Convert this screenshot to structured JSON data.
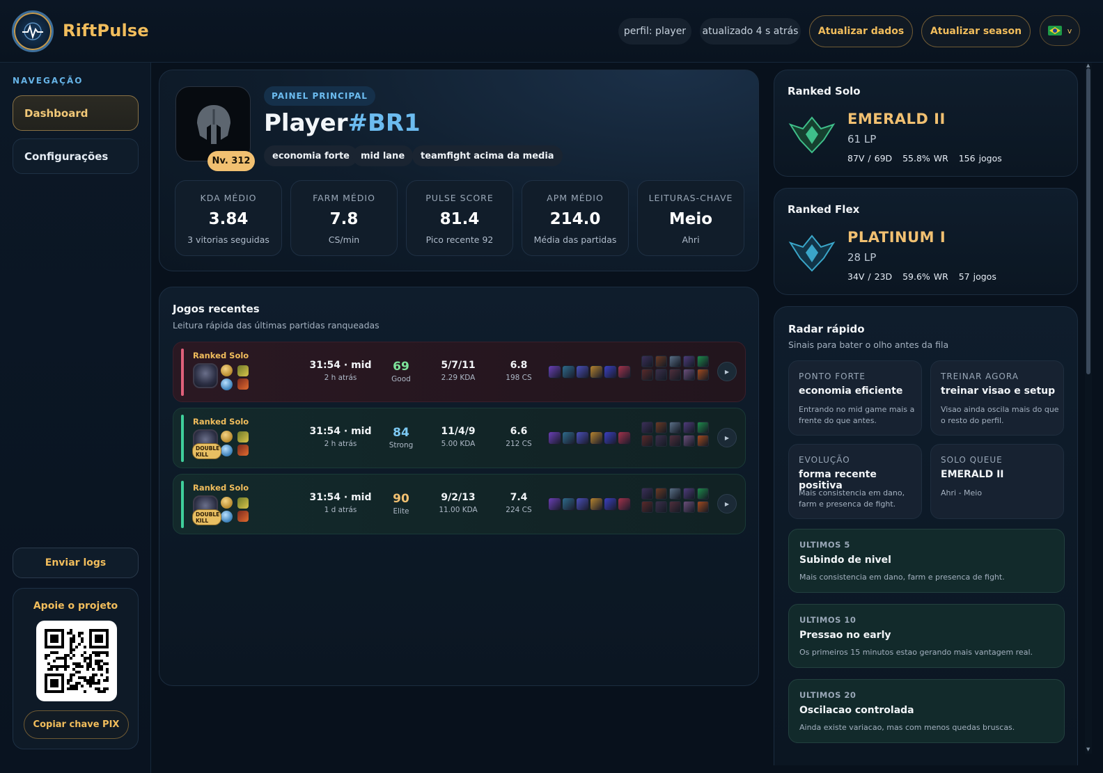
{
  "app": {
    "brand": "RiftPulse",
    "profile_chip": "perfil: player",
    "updated_chip": "atualizado 4 s atrás",
    "refresh_data_label": "Atualizar dados",
    "refresh_season_label": "Atualizar season",
    "language_caret": "v",
    "language_icon": "brazil-flag-icon"
  },
  "sidebar": {
    "title": "NAVEGAÇÃO",
    "items": [
      {
        "label": "Dashboard",
        "active": true
      },
      {
        "label": "Configurações",
        "active": false
      }
    ],
    "send_logs": "Enviar logs",
    "support_title": "Apoie o projeto",
    "copy_pix": "Copiar chave PIX"
  },
  "profile": {
    "pill": "PAINEL PRINCIPAL",
    "name": "Player",
    "tag": "#BR1",
    "level": "Nv. 312",
    "tags": [
      "economia forte",
      "mid lane",
      "teamfight acima da media"
    ],
    "stats": [
      {
        "label": "KDA MÉDIO",
        "value": "3.84",
        "sub": "3 vitorias seguidas"
      },
      {
        "label": "FARM MÉDIO",
        "value": "7.8",
        "sub": "CS/min"
      },
      {
        "label": "PULSE SCORE",
        "value": "81.4",
        "sub": "Pico recente 92"
      },
      {
        "label": "APM MÉDIO",
        "value": "214.0",
        "sub": "Média das partidas"
      },
      {
        "label": "LEITURAS-CHAVE",
        "value": "Meio",
        "sub": "Ahri"
      }
    ]
  },
  "recent": {
    "title": "Jogos recentes",
    "subtitle": "Leitura rápida das últimas partidas ranqueadas",
    "games": [
      {
        "queue": "Ranked Solo",
        "result": "loss",
        "badge": "",
        "time": "31:54 · mid",
        "ago": "2 h atrás",
        "score": "69",
        "score_label": "Good",
        "score_color": "#7de39a",
        "kda": "5/7/11",
        "kda_ratio": "2.29 KDA",
        "cs_per_min": "6.8",
        "cs": "198 CS"
      },
      {
        "queue": "Ranked Solo",
        "result": "win",
        "badge": "DOUBLE KILL",
        "time": "31:54 · mid",
        "ago": "2 h atrás",
        "score": "84",
        "score_label": "Strong",
        "score_color": "#7cc8f2",
        "kda": "11/4/9",
        "kda_ratio": "5.00 KDA",
        "cs_per_min": "6.6",
        "cs": "212 CS"
      },
      {
        "queue": "Ranked Solo",
        "result": "win",
        "badge": "DOUBLE KILL",
        "time": "31:54 · mid",
        "ago": "1 d atrás",
        "score": "90",
        "score_label": "Elite",
        "score_color": "#f1c071",
        "kda": "9/2/13",
        "kda_ratio": "11.00 KDA",
        "cs_per_min": "7.4",
        "cs": "224 CS"
      }
    ]
  },
  "ranks": [
    {
      "queue": "Ranked Solo",
      "tier": "EMERALD II",
      "lp": "61 LP",
      "record": "87V / 69D",
      "wr": "55.8% WR",
      "games": "156 jogos",
      "emblem": "emerald-emblem-icon",
      "color": "#3fbf8a"
    },
    {
      "queue": "Ranked Flex",
      "tier": "PLATINUM I",
      "lp": "28 LP",
      "record": "34V / 23D",
      "wr": "59.6% WR",
      "games": "57 jogos",
      "emblem": "platinum-emblem-icon",
      "color": "#3aa6c9"
    }
  ],
  "radar": {
    "title": "Radar rápido",
    "subtitle": "Sinais para bater o olho antes da fila",
    "boxes": [
      {
        "kicker": "PONTO FORTE",
        "head": "economia eficiente",
        "text": "Entrando no mid game mais a frente do que antes."
      },
      {
        "kicker": "TREINAR AGORA",
        "head": "treinar visao e setup",
        "text": "Visao ainda oscila mais do que o resto do perfil."
      },
      {
        "kicker": "EVOLUÇÃO",
        "head": "forma recente positiva",
        "text": "Mais consistencia em dano, farm e presenca de fight."
      },
      {
        "kicker": "SOLO QUEUE",
        "head": "EMERALD II",
        "text": "Ahri - Meio"
      }
    ],
    "trends": [
      {
        "kicker": "ULTIMOS 5",
        "head": "Subindo de nivel",
        "text": "Mais consistencia em dano, farm e presenca de fight."
      },
      {
        "kicker": "ULTIMOS 10",
        "head": "Pressao no early",
        "text": "Os primeiros 15 minutos estao gerando mais vantagem real."
      },
      {
        "kicker": "ULTIMOS 20",
        "head": "Oscilacao controlada",
        "text": "Ainda existe variacao, mas com menos quedas bruscas."
      }
    ]
  }
}
